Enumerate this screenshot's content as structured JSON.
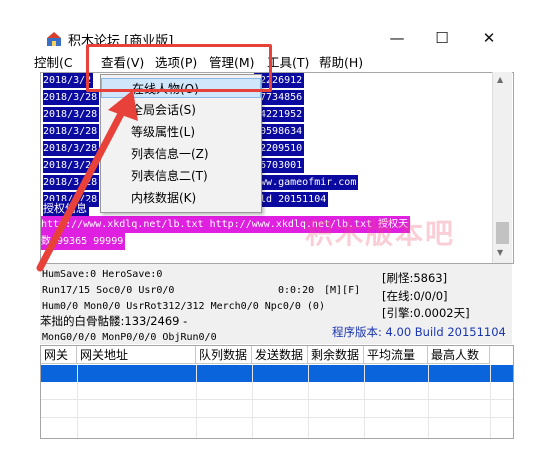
{
  "window": {
    "title": "积木论坛 [商业版]",
    "minimize_glyph": "—",
    "maximize_glyph": "☐",
    "close_glyph": "✕"
  },
  "menu": {
    "control": "控制(C",
    "view": "查看(V)",
    "options": "选项(P)",
    "manage": "管理(M)",
    "tools": "工具(T)",
    "help": "帮助(H)"
  },
  "view_dropdown": {
    "items": [
      "在线人物(O)",
      "全局会话(S)",
      "等级属性(L)",
      "列表信息一(Z)",
      "列表信息二(T)",
      "内核数据(K)"
    ],
    "highlighted_index": 0
  },
  "log": {
    "lines": [
      {
        "left": "2018/3/2",
        "right": "42226912"
      },
      {
        "left": "2018/3/28",
        "right": "47734856"
      },
      {
        "left": "2018/3/28",
        "right": "64221952"
      },
      {
        "left": "2018/3/28",
        "right": "40598634"
      },
      {
        "left": "2018/3/28",
        "right": "22209510"
      },
      {
        "left": "2018/3/28",
        "right": "86703001"
      },
      {
        "left": "2018/3/28",
        "right": "www.gameofmir.com"
      },
      {
        "left": "2018/3/28",
        "right": "ild 20151104"
      }
    ],
    "auth_label": "授权信息",
    "auth_line": "http://www.xkdlq.net/lb.txt http://www.xkdlq.net/lb.txt 授权天",
    "auth_days": "数 99365 99999"
  },
  "status": {
    "line1": "HumSave:0 HeroSave:0",
    "line2": "Run17/15 Soc0/0 Usr0/0",
    "timer": "0:0:20",
    "mode": "[M][F]",
    "line3": "Hum0/0 Mon0/0 UsrRot312/312 Merch0/0 Npc0/0 (0)",
    "line4": "苯拙的白骨骷髅:133/2469 -",
    "line5": "MonG0/0/0 MonP0/0/0 ObjRun0/0",
    "refresh": "[刷怪:5863]",
    "online": "[在线:0/0/0]",
    "engine": "[引擎:0.0002天]",
    "version": "程序版本: 4.00 Build 20151104"
  },
  "table": {
    "headers": [
      "网关",
      "网关地址",
      "队列数据",
      "发送数据",
      "剩余数据",
      "平均流量",
      "最高人数"
    ]
  },
  "watermark": "积木版本吧",
  "colors": {
    "log_bg": "#0a0aa0",
    "auth_bg": "#e020e0",
    "selection": "#0a64dc",
    "annotation": "#e8413a",
    "version_text": "#1a35b0"
  }
}
